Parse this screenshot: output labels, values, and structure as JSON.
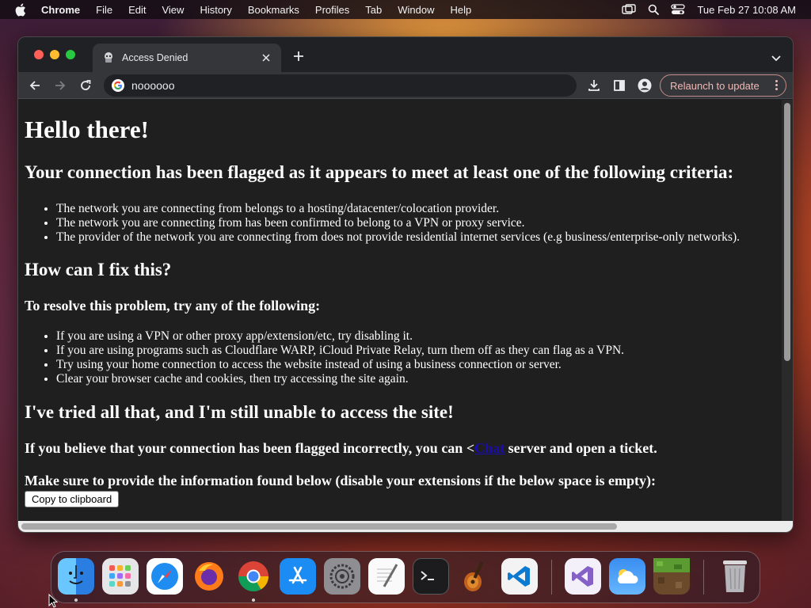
{
  "menubar": {
    "app_name": "Chrome",
    "items": [
      "File",
      "Edit",
      "View",
      "History",
      "Bookmarks",
      "Profiles",
      "Tab",
      "Window",
      "Help"
    ],
    "clock": "Tue Feb 27  10:08 AM"
  },
  "browser": {
    "tab_title": "Access Denied",
    "address": "noooooo",
    "relaunch_label": "Relaunch to update"
  },
  "page": {
    "heading": "Hello there!",
    "criteria_heading": "Your connection has been flagged as it appears to meet at least one of the following criteria:",
    "criteria": [
      "The network you are connecting from belongs to a hosting/datacenter/colocation provider.",
      "The network you are connecting from has been confirmed to belong to a VPN or proxy service.",
      "The provider of the network you are connecting from does not provide residential internet services (e.g business/enterprise-only networks)."
    ],
    "fix_heading": "How can I fix this?",
    "fix_subheading": "To resolve this problem, try any of the following:",
    "fixes": [
      "If you are using a VPN or other proxy app/extension/etc, try disabling it.",
      "If you are using programs such as Cloudflare WARP, iCloud Private Relay, turn them off as they can flag as a VPN.",
      "Try using your home connection to access the website instead of using a business connection or server.",
      "Clear your browser cache and cookies, then try accessing the site again."
    ],
    "tried_heading": "I've tried all that, and I'm still unable to access the site!",
    "incorrect_prefix": "If you believe that your connection has been flagged incorrectly, you can <",
    "incorrect_link": "Chat",
    "incorrect_suffix": " server and open a ticket.",
    "info_heading": "Make sure to provide the information found below (disable your extensions if the below space is empty):",
    "copy_button": "Copy to clipboard"
  },
  "dock": {
    "apps": [
      "finder-icon",
      "launchpad-icon",
      "safari-icon",
      "firefox-icon",
      "chrome-icon",
      "app-store-icon",
      "system-settings-icon",
      "textedit-icon",
      "terminal-icon",
      "garageband-icon",
      "vscode-icon",
      "visual-studio-icon",
      "weather-icon",
      "minecraft-icon",
      "trash-icon"
    ]
  },
  "colors": {
    "page_background": "#1f1f1f",
    "link": "#1a0dab",
    "relaunch_border": "#c58a8a"
  }
}
